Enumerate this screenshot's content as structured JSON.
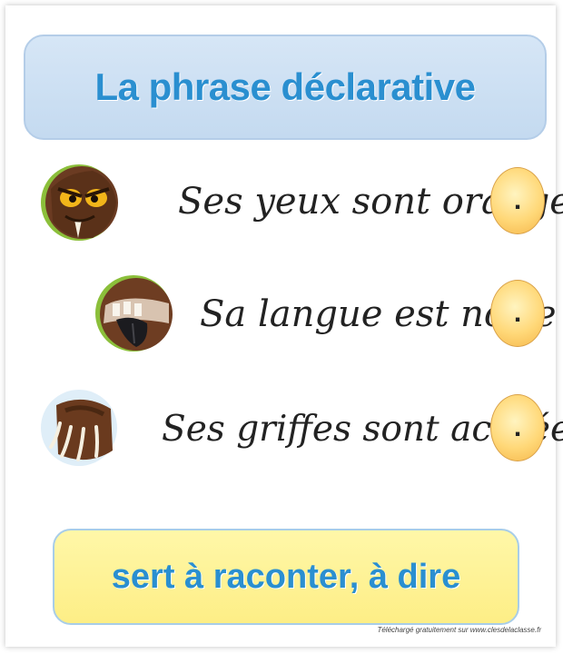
{
  "title": "La phrase déclarative",
  "sentences": [
    {
      "text": "Ses yeux sont orange",
      "punctuation": ".",
      "image": "monster-eyes-image"
    },
    {
      "text": "Sa langue est noire",
      "punctuation": ".",
      "image": "monster-tongue-image"
    },
    {
      "text": "Ses griffes sont acérées",
      "punctuation": ".",
      "image": "monster-claws-image"
    }
  ],
  "definition": "sert à raconter, à dire",
  "credit": "Téléchargé gratuitement sur www.clesdelaclasse.fr",
  "colors": {
    "title_text": "#2a8fd0",
    "title_box": "#c9ddf1",
    "definition_box": "#fdef8c",
    "punctuation_circle": "#ffd274"
  }
}
